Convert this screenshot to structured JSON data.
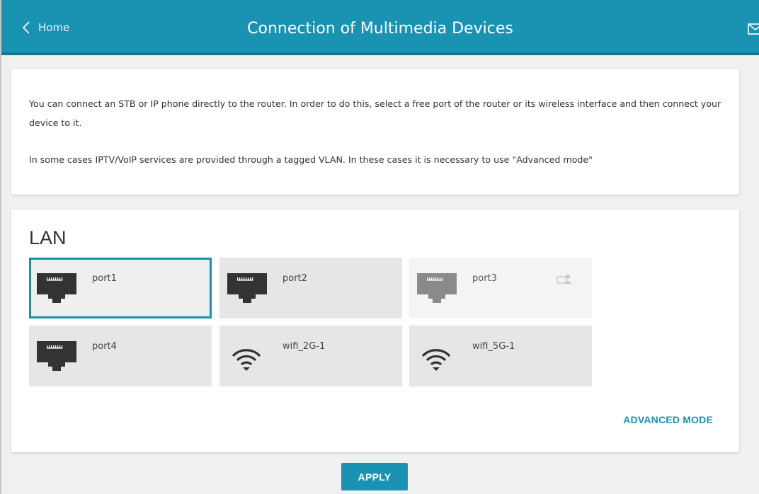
{
  "header": {
    "back_label": "Home",
    "title": "Connection of Multimedia Devices"
  },
  "info": {
    "paragraph1": "You can connect an STB or IP phone directly to the router. In order to do this, select a free port of the router or its wireless interface and then connect your device to it.",
    "paragraph2": "In some cases IPTV/VoIP services are provided through a tagged VLAN. In these cases it is necessary to use \"Advanced mode\""
  },
  "lan": {
    "title": "LAN",
    "ports": [
      {
        "label": "port1",
        "type": "ethernet",
        "state": "selected",
        "icon": "ethernet-port-icon"
      },
      {
        "label": "port2",
        "type": "ethernet",
        "state": "normal",
        "icon": "ethernet-port-icon"
      },
      {
        "label": "port3",
        "type": "ethernet",
        "state": "disabled",
        "icon": "ethernet-port-icon",
        "badge_icon": "occupied-device-icon"
      },
      {
        "label": "port4",
        "type": "ethernet",
        "state": "normal",
        "icon": "ethernet-port-icon"
      },
      {
        "label": "wifi_2G-1",
        "type": "wifi",
        "state": "normal",
        "icon": "wifi-icon"
      },
      {
        "label": "wifi_5G-1",
        "type": "wifi",
        "state": "normal",
        "icon": "wifi-icon"
      }
    ],
    "advanced_mode_label": "ADVANCED MODE"
  },
  "actions": {
    "apply_label": "APPLY"
  },
  "colors": {
    "accent": "#1a93b3",
    "header_border": "#17768f",
    "selected_border": "#1b8fab",
    "icon_dark": "#333333",
    "icon_disabled": "#8a8a8a"
  },
  "icons": {
    "back": "chevron-left-icon",
    "mail": "envelope-icon"
  }
}
